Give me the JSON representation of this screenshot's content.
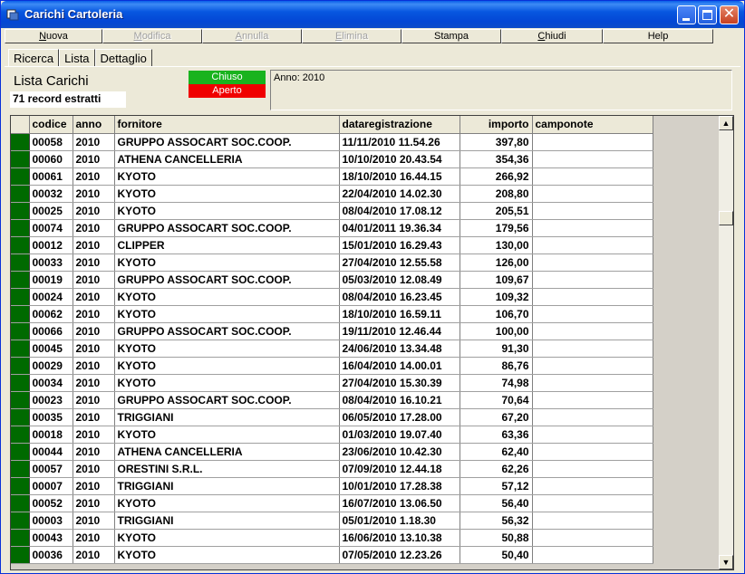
{
  "window": {
    "title": "Carichi Cartoleria"
  },
  "menu": [
    {
      "label": "Nuova",
      "ul": "N",
      "rest": "uova",
      "enabled": true,
      "width": 108
    },
    {
      "label": "Modifica",
      "ul": "M",
      "rest": "odifica",
      "enabled": false,
      "width": 110
    },
    {
      "label": "Annulla",
      "ul": "A",
      "rest": "nnulla",
      "enabled": false,
      "width": 110
    },
    {
      "label": "Elimina",
      "ul": "E",
      "rest": "limina",
      "enabled": false,
      "width": 110
    },
    {
      "label": "Stampa",
      "ul": "",
      "rest": "Stampa",
      "enabled": true,
      "width": 110
    },
    {
      "label": "Chiudi",
      "ul": "C",
      "rest": "hiudi",
      "enabled": true,
      "width": 112
    },
    {
      "label": "Help",
      "ul": "",
      "rest": "Help",
      "enabled": true,
      "width": 122
    }
  ],
  "tabs": [
    {
      "label": "Ricerca",
      "active": false
    },
    {
      "label": "Lista",
      "active": true
    },
    {
      "label": "Dettaglio",
      "active": false
    }
  ],
  "list": {
    "title": "Lista Carichi",
    "records": "71 record estratti",
    "legend_chiuso": "Chiuso",
    "legend_aperto": "Aperto",
    "filter_info": "Anno: 2010"
  },
  "colors": {
    "chiuso": "#19B31E",
    "aperto": "#F00000",
    "row_indicator": "#006A00"
  },
  "grid": {
    "columns": [
      "codice",
      "anno",
      "fornitore",
      "dataregistrazione",
      "importo",
      "camponote"
    ],
    "rows": [
      [
        "00058",
        "2010",
        "GRUPPO ASSOCART SOC.COOP.",
        "11/11/2010 11.54.26",
        "397,80",
        ""
      ],
      [
        "00060",
        "2010",
        "ATHENA CANCELLERIA",
        "10/10/2010 20.43.54",
        "354,36",
        ""
      ],
      [
        "00061",
        "2010",
        "KYOTO",
        "18/10/2010 16.44.15",
        "266,92",
        ""
      ],
      [
        "00032",
        "2010",
        "KYOTO",
        "22/04/2010 14.02.30",
        "208,80",
        ""
      ],
      [
        "00025",
        "2010",
        "KYOTO",
        "08/04/2010 17.08.12",
        "205,51",
        ""
      ],
      [
        "00074",
        "2010",
        "GRUPPO ASSOCART SOC.COOP.",
        "04/01/2011 19.36.34",
        "179,56",
        ""
      ],
      [
        "00012",
        "2010",
        "CLIPPER",
        "15/01/2010 16.29.43",
        "130,00",
        ""
      ],
      [
        "00033",
        "2010",
        "KYOTO",
        "27/04/2010 12.55.58",
        "126,00",
        ""
      ],
      [
        "00019",
        "2010",
        "GRUPPO ASSOCART SOC.COOP.",
        "05/03/2010 12.08.49",
        "109,67",
        ""
      ],
      [
        "00024",
        "2010",
        "KYOTO",
        "08/04/2010 16.23.45",
        "109,32",
        ""
      ],
      [
        "00062",
        "2010",
        "KYOTO",
        "18/10/2010 16.59.11",
        "106,70",
        ""
      ],
      [
        "00066",
        "2010",
        "GRUPPO ASSOCART SOC.COOP.",
        "19/11/2010 12.46.44",
        "100,00",
        ""
      ],
      [
        "00045",
        "2010",
        "KYOTO",
        "24/06/2010 13.34.48",
        "91,30",
        ""
      ],
      [
        "00029",
        "2010",
        "KYOTO",
        "16/04/2010 14.00.01",
        "86,76",
        ""
      ],
      [
        "00034",
        "2010",
        "KYOTO",
        "27/04/2010 15.30.39",
        "74,98",
        ""
      ],
      [
        "00023",
        "2010",
        "GRUPPO ASSOCART SOC.COOP.",
        "08/04/2010 16.10.21",
        "70,64",
        ""
      ],
      [
        "00035",
        "2010",
        "TRIGGIANI",
        "06/05/2010 17.28.00",
        "67,20",
        ""
      ],
      [
        "00018",
        "2010",
        "KYOTO",
        "01/03/2010 19.07.40",
        "63,36",
        ""
      ],
      [
        "00044",
        "2010",
        "ATHENA CANCELLERIA",
        "23/06/2010 10.42.30",
        "62,40",
        ""
      ],
      [
        "00057",
        "2010",
        "ORESTINI S.R.L.",
        "07/09/2010 12.44.18",
        "62,26",
        ""
      ],
      [
        "00007",
        "2010",
        "TRIGGIANI",
        "10/01/2010 17.28.38",
        "57,12",
        ""
      ],
      [
        "00052",
        "2010",
        "KYOTO",
        "16/07/2010 13.06.50",
        "56,40",
        ""
      ],
      [
        "00003",
        "2010",
        "TRIGGIANI",
        "05/01/2010 1.18.30",
        "56,32",
        ""
      ],
      [
        "00043",
        "2010",
        "KYOTO",
        "16/06/2010 13.10.38",
        "50,88",
        ""
      ],
      [
        "00036",
        "2010",
        "KYOTO",
        "07/05/2010 12.23.26",
        "50,40",
        ""
      ]
    ]
  }
}
